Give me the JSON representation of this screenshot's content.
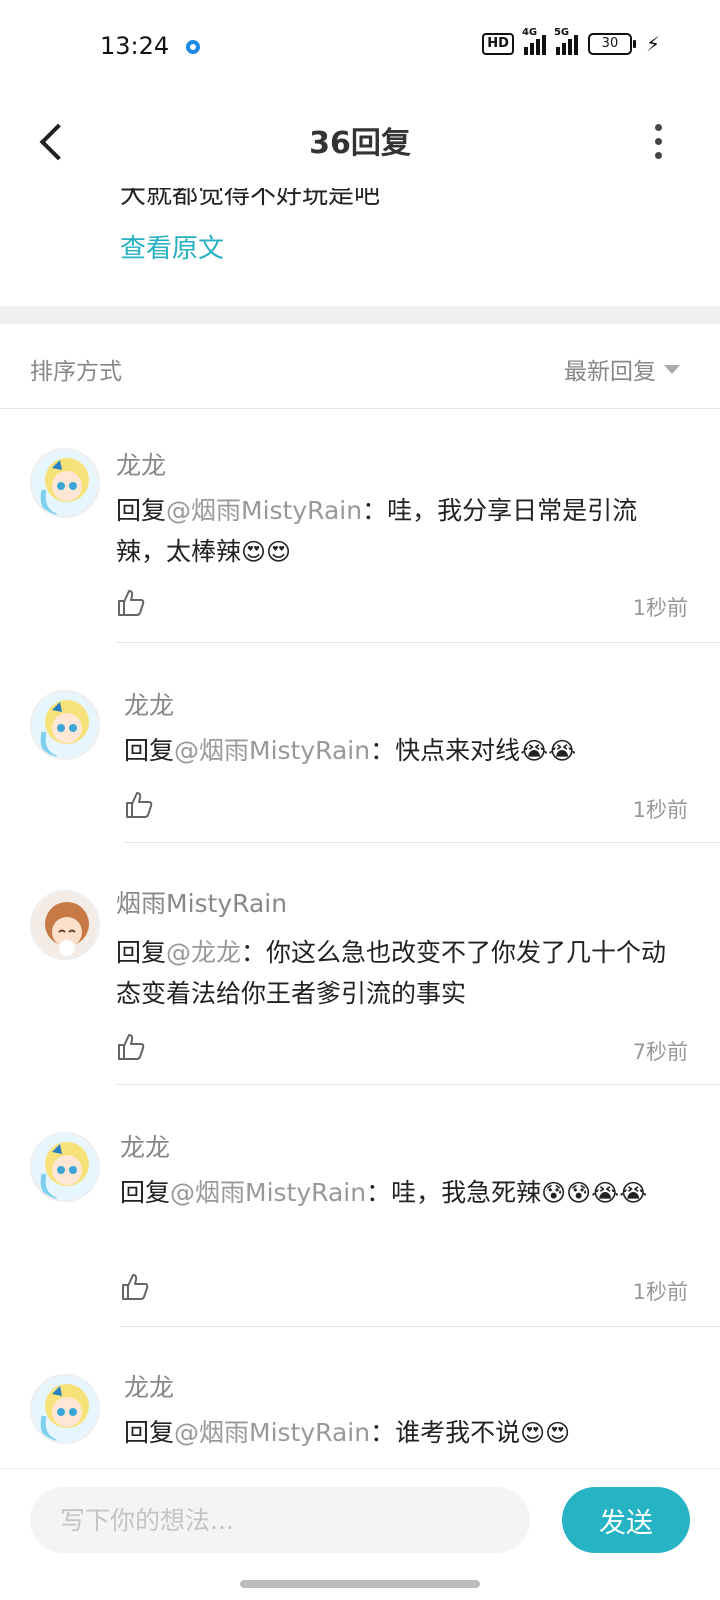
{
  "status": {
    "time": "13:24",
    "hd": "HD",
    "net1": "4G",
    "net2": "5G",
    "battery": "30"
  },
  "header": {
    "title": "36回复"
  },
  "original": {
    "snippet": "大就都觉得不好玩是吧",
    "view_original": "查看原文"
  },
  "sort": {
    "label": "排序方式",
    "selected": "最新回复"
  },
  "comments": [
    {
      "name": "龙龙",
      "prefix": "回复",
      "mention": "@烟雨MistyRain",
      "text": "：哇，我分享日常是引流辣，太棒辣",
      "emoji": "😍😍",
      "time": "1秒前"
    },
    {
      "name": "龙龙",
      "prefix": "回复",
      "mention": "@烟雨MistyRain",
      "text": "：快点来对线",
      "emoji": "😭😭",
      "time": "1秒前"
    },
    {
      "name": "烟雨MistyRain",
      "prefix": "回复",
      "mention": "@龙龙",
      "text": "：你这么急也改变不了你发了几十个动态变着法给你王者爹引流的事实",
      "emoji": "",
      "time": "7秒前"
    },
    {
      "name": "龙龙",
      "prefix": "回复",
      "mention": "@烟雨MistyRain",
      "text": "：哇，我急死辣",
      "emoji": "😰😰😭😭",
      "time": "1秒前"
    },
    {
      "name": "龙龙",
      "prefix": "回复",
      "mention": "@烟雨MistyRain",
      "text": "：谁考我不说",
      "emoji": "😍😍",
      "time": ""
    }
  ],
  "input": {
    "placeholder": "写下你的想法...",
    "send_label": "发送"
  },
  "colors": {
    "accent": "#26b4c4",
    "link": "#26b0c1"
  },
  "icons": [
    "back-arrow-icon",
    "more-vertical-icon",
    "sort-caret-icon",
    "thumbs-up-icon"
  ]
}
